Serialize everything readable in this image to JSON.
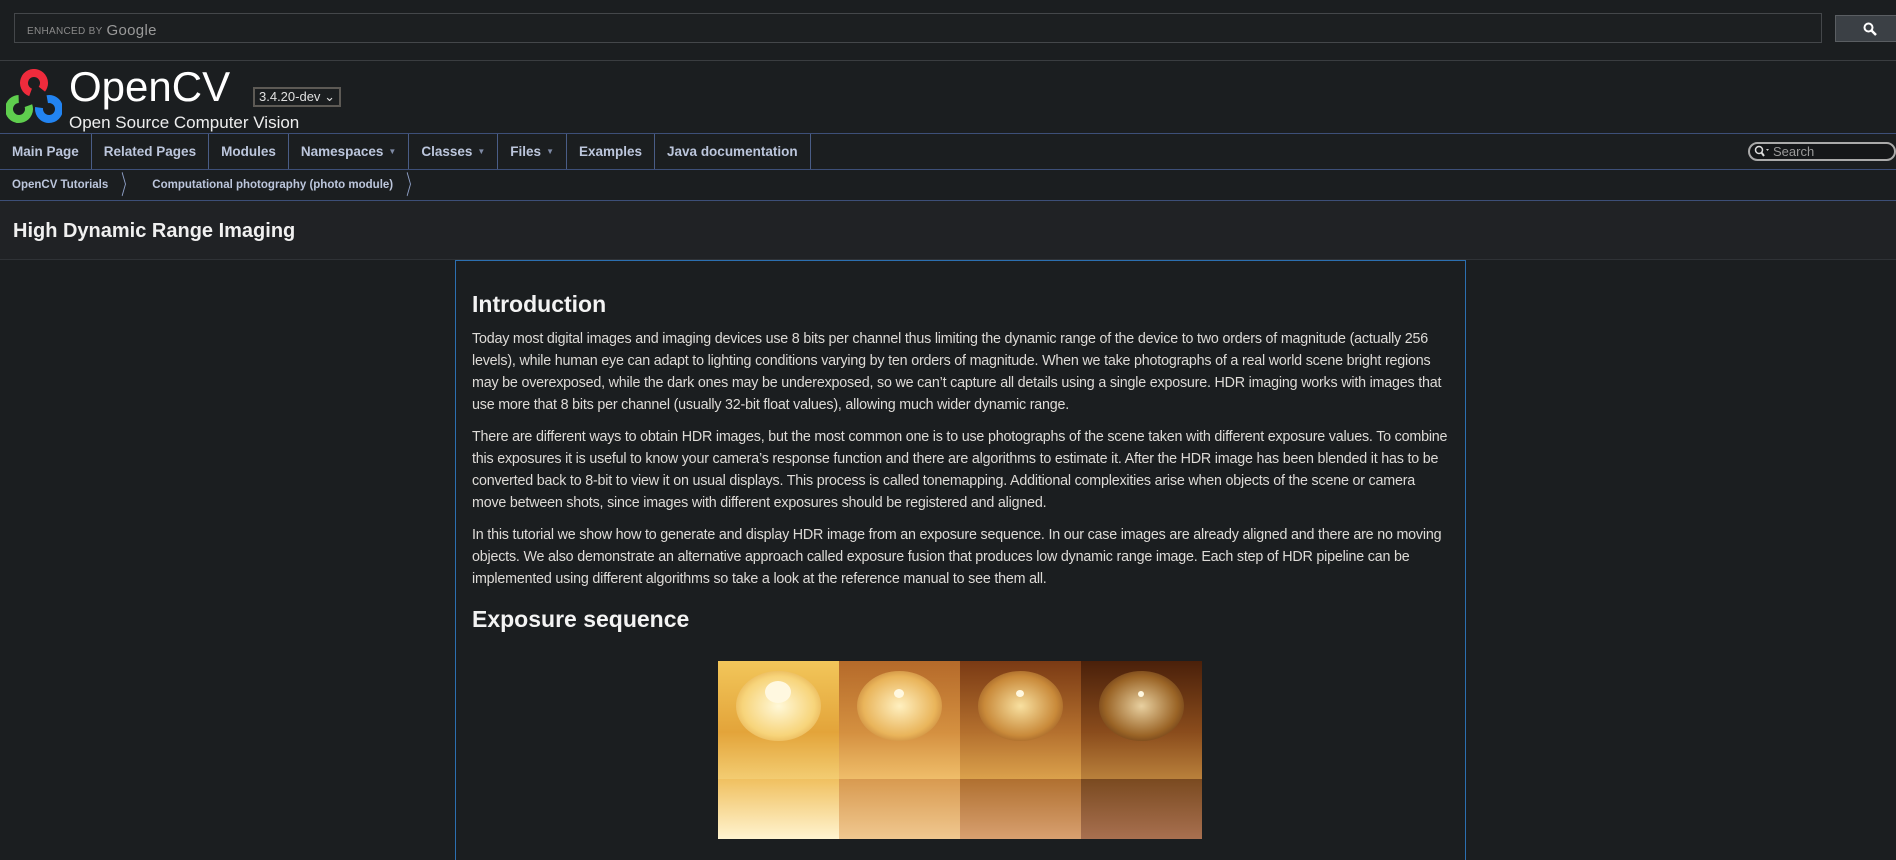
{
  "google_search": {
    "enhanced_by": "ENHANCED BY",
    "brand": "Google",
    "button_icon": "search-icon"
  },
  "project": {
    "name": "OpenCV",
    "version": "3.4.20-dev",
    "brief": "Open Source Computer Vision"
  },
  "nav": {
    "items": [
      {
        "label": "Main Page",
        "dropdown": false
      },
      {
        "label": "Related Pages",
        "dropdown": false
      },
      {
        "label": "Modules",
        "dropdown": false
      },
      {
        "label": "Namespaces",
        "dropdown": true
      },
      {
        "label": "Classes",
        "dropdown": true
      },
      {
        "label": "Files",
        "dropdown": true
      },
      {
        "label": "Examples",
        "dropdown": false
      },
      {
        "label": "Java documentation",
        "dropdown": false
      }
    ],
    "search_placeholder": "Search"
  },
  "breadcrumb": [
    "OpenCV Tutorials",
    "Computational photography (photo module)"
  ],
  "page_title": "High Dynamic Range Imaging",
  "content": {
    "h_intro": "Introduction",
    "p1": "Today most digital images and imaging devices use 8 bits per channel thus limiting the dynamic range of the device to two orders of magnitude (actually 256 levels), while human eye can adapt to lighting conditions varying by ten orders of magnitude. When we take photographs of a real world scene bright regions may be overexposed, while the dark ones may be underexposed, so we can’t capture all details using a single exposure. HDR imaging works with images that use more that 8 bits per channel (usually 32-bit float values), allowing much wider dynamic range.",
    "p2": "There are different ways to obtain HDR images, but the most common one is to use photographs of the scene taken with different exposure values. To combine this exposures it is useful to know your camera’s response function and there are algorithms to estimate it. After the HDR image has been blended it has to be converted back to 8-bit to view it on usual displays. This process is called tonemapping. Additional complexities arise when objects of the scene or camera move between shots, since images with different exposures should be registered and aligned.",
    "p3": "In this tutorial we show how to generate and display HDR image from an exposure sequence. In our case images are already aligned and there are no moving objects. We also demonstrate an alternative approach called exposure fusion that produces low dynamic range image. Each step of HDR pipeline can be implemented using different algorithms so take a look at the reference manual to see them all.",
    "h_exposure": "Exposure sequence"
  }
}
